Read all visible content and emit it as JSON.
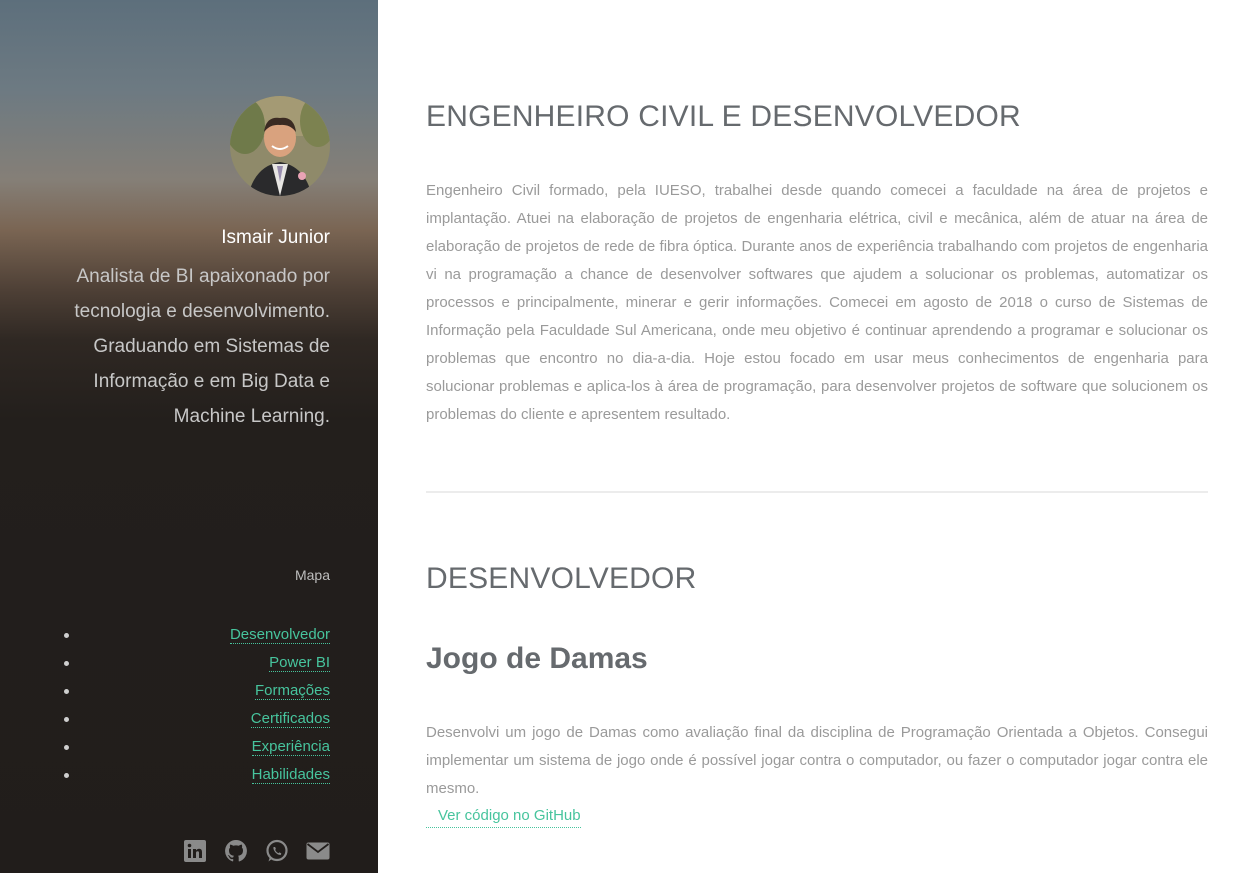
{
  "profile": {
    "name": "Ismair Junior",
    "bio": "Analista de BI apaixonado por tecnologia e desenvolvimento. Graduando em Sistemas de Informação e em Big Data e Machine Learning."
  },
  "sidebar": {
    "map_label": "Mapa",
    "nav": [
      {
        "label": "Desenvolvedor"
      },
      {
        "label": "Power BI"
      },
      {
        "label": "Formações"
      },
      {
        "label": "Certificados"
      },
      {
        "label": "Experiência"
      },
      {
        "label": "Habilidades"
      }
    ],
    "social_icons": [
      "linkedin-icon",
      "github-icon",
      "whatsapp-icon",
      "email-icon"
    ]
  },
  "about": {
    "title": "ENGENHEIRO CIVIL E DESENVOLVEDOR",
    "text": "Engenheiro Civil formado, pela IUESO, trabalhei desde quando comecei a faculdade na área de projetos e implantação. Atuei na elaboração de projetos de engenharia elétrica, civil e mecânica, além de atuar na área de elaboração de projetos de rede de fibra óptica. Durante anos de experiência trabalhando com projetos de engenharia vi na programação a chance de desenvolver softwares que ajudem a solucionar os problemas, automatizar os processos e principalmente, minerar e gerir informações. Comecei em agosto de 2018 o curso de Sistemas de Informação pela Faculdade Sul Americana, onde meu objetivo é continuar aprendendo a programar e solucionar os problemas que encontro no dia-a-dia. Hoje estou focado em usar meus conhecimentos de engenharia para solucionar problemas e aplica-los à área de programação, para desenvolver projetos de software que solucionem os problemas do cliente e apresentem resultado."
  },
  "developer": {
    "title": "DESENVOLVEDOR",
    "project": {
      "title": "Jogo de Damas",
      "text": "Desenvolvi um jogo de Damas como avaliação final da disciplina de Programação Orientada a Objetos. Consegui implementar um sistema de jogo onde é possível jogar contra o computador, ou fazer o computador jogar contra ele mesmo.",
      "link_label": "Ver código no GitHub",
      "link_icon": "github-icon"
    }
  },
  "colors": {
    "accent": "#47c49d",
    "heading": "#666a6e",
    "body_text": "#9a9a9a",
    "sidebar_dark": "#211d1b"
  }
}
